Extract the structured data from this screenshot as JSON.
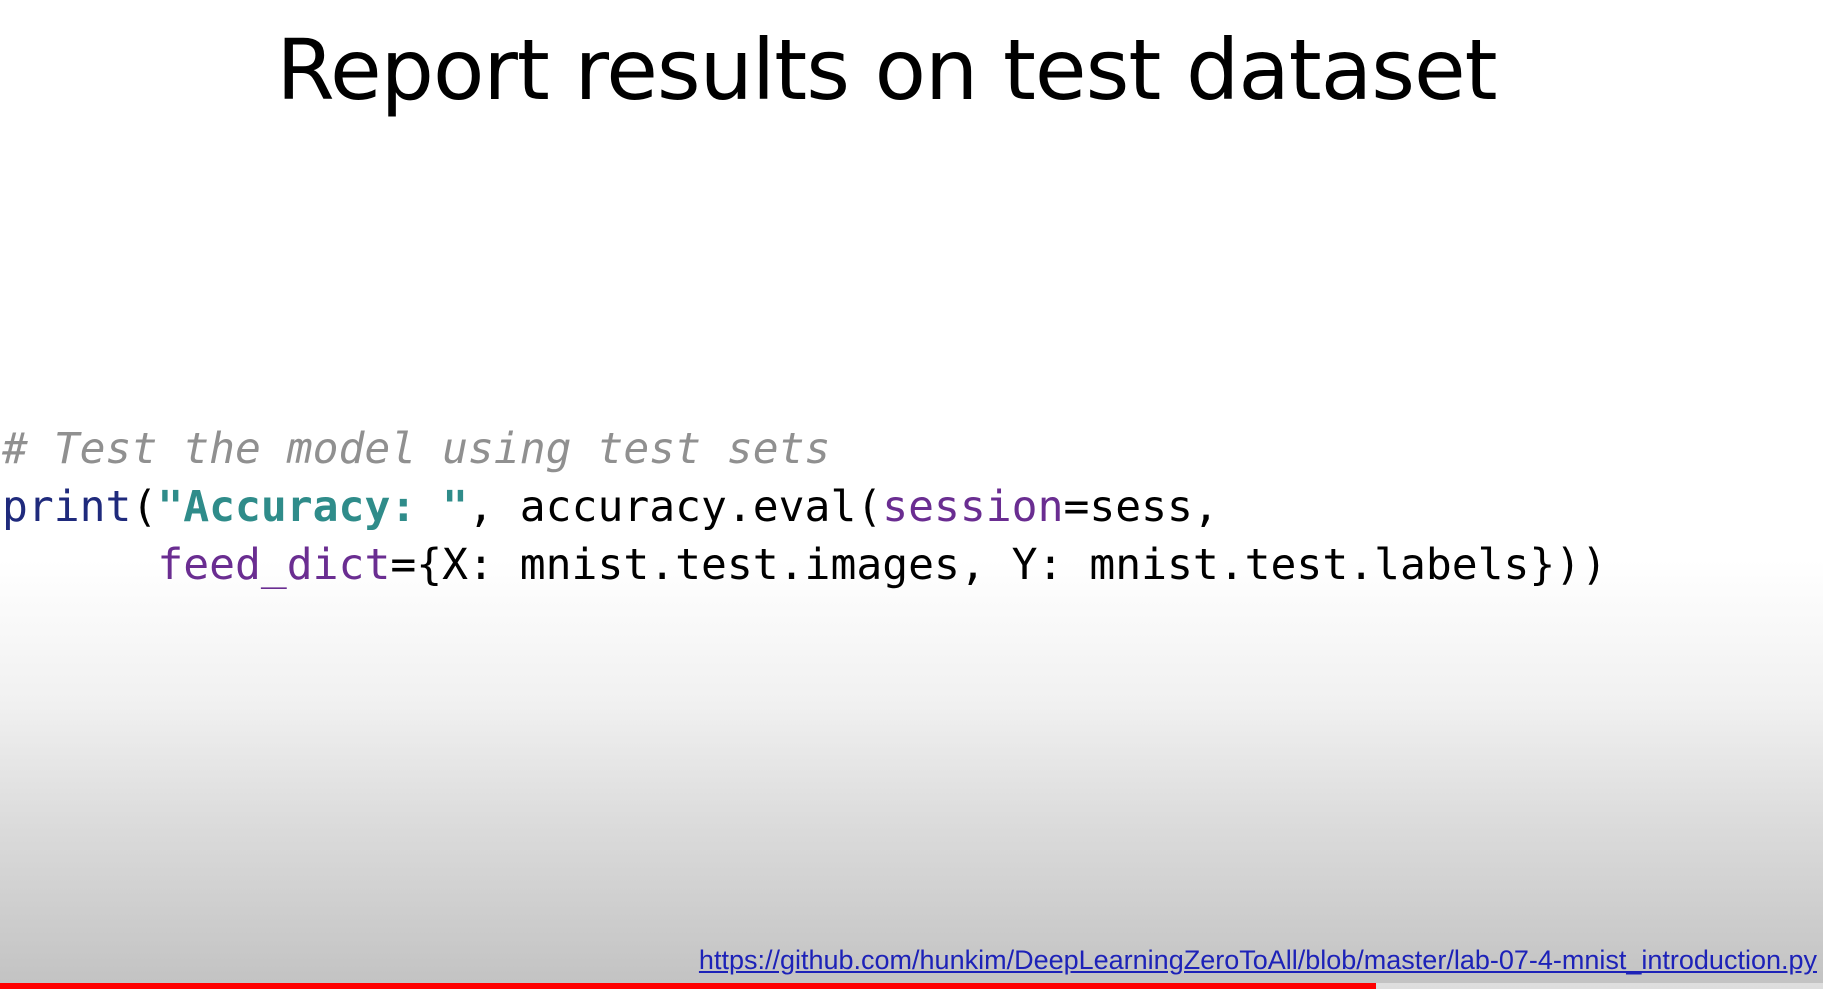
{
  "slide": {
    "title": "Report results on test dataset"
  },
  "code": {
    "comment": "# Test the model using test sets",
    "line2": {
      "builtin": "print",
      "open_paren": "(",
      "string": "\"Accuracy: \"",
      "middle": ", accuracy.eval(",
      "kwarg": "session",
      "tail": "=sess,"
    },
    "line3": {
      "indent": "      ",
      "kwarg": "feed_dict",
      "tail": "={X: mnist.test.images, Y: mnist.test.labels}))"
    }
  },
  "source_link": {
    "text": "https://github.com/hunkim/DeepLearningZeroToAll/blob/master/lab-07-4-mnist_introduction.py"
  },
  "video_progress": {
    "played_fraction": 0.755
  },
  "colors": {
    "progress": "#ff0000",
    "link": "#1d22b8",
    "comment": "#909090",
    "builtin": "#1f2a7c",
    "string": "#2f8c8a",
    "kwarg": "#6a2d91"
  }
}
